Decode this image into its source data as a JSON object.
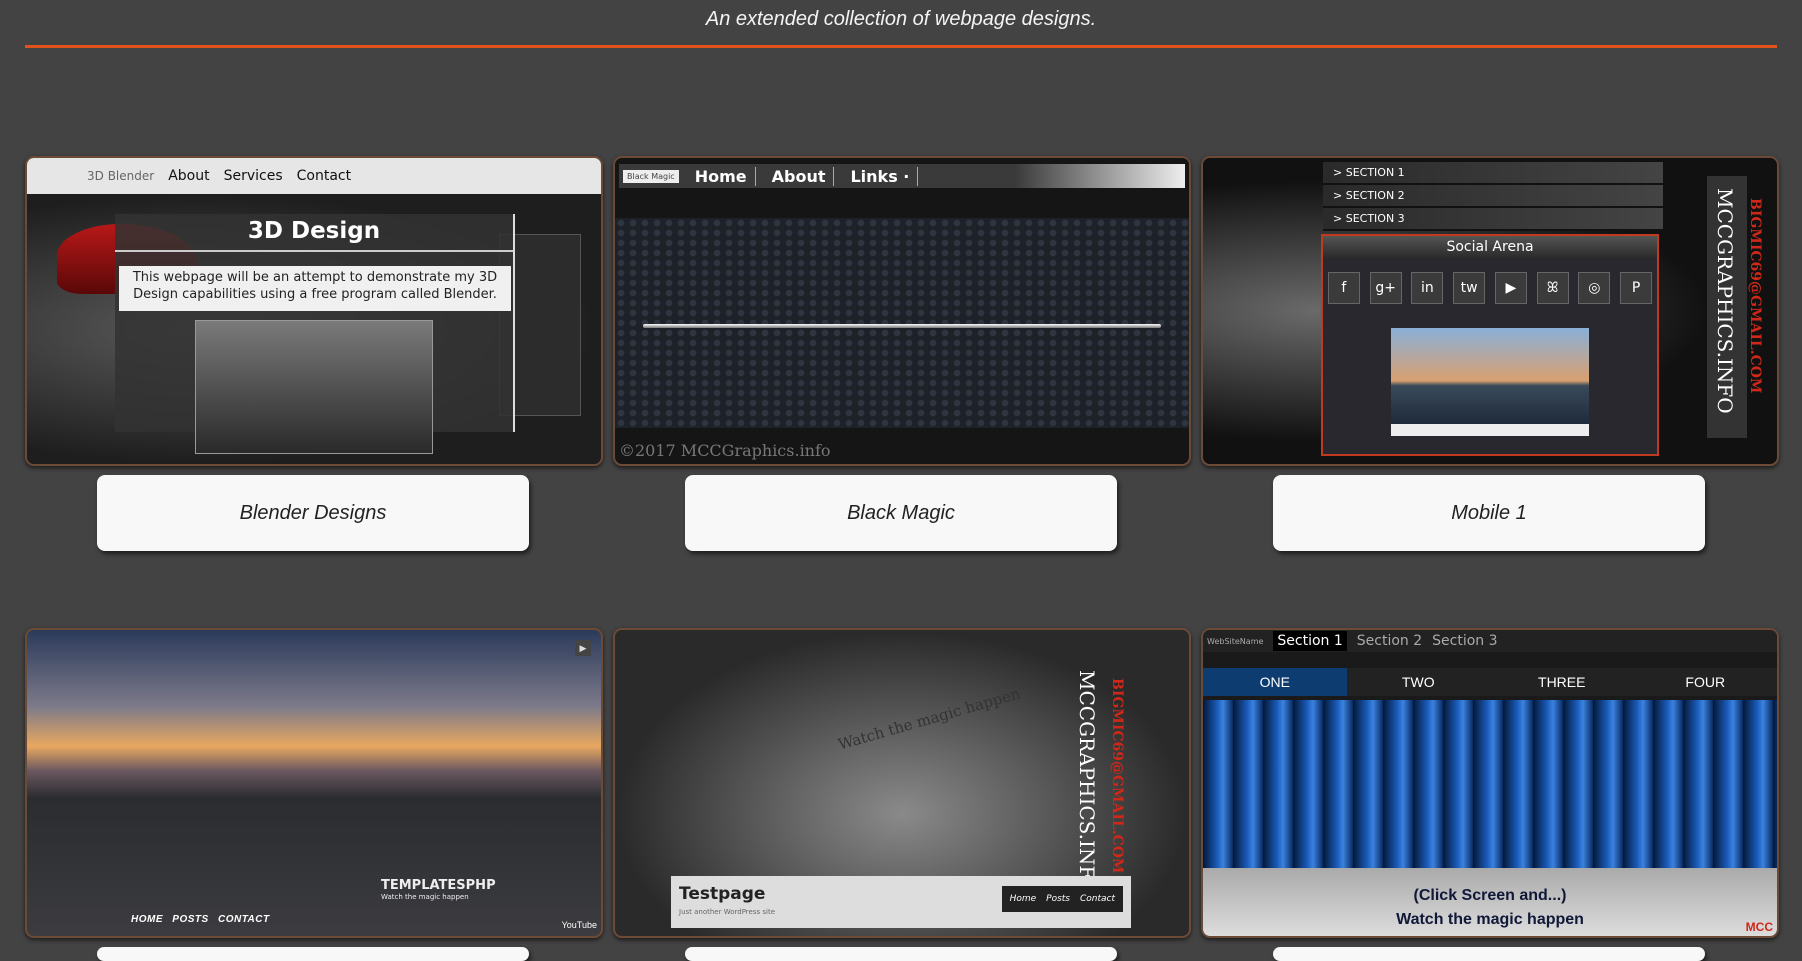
{
  "header": {
    "tagline": "An extended collection of webpage designs.",
    "accent_color": "#e0541c"
  },
  "cards": [
    {
      "label": "Blender Designs",
      "preview": {
        "brand": "3D Blender",
        "nav": [
          "About",
          "Services",
          "Contact"
        ],
        "title": "3D Design",
        "description": "This webpage will be an attempt to demonstrate my 3D Design capabilities using a free program called Blender."
      }
    },
    {
      "label": "Black Magic",
      "preview": {
        "brand": "Black Magic",
        "nav": [
          "Home",
          "About",
          "Links ·"
        ],
        "footer": "©2017 MCCGraphics.info"
      }
    },
    {
      "label": "Mobile 1",
      "preview": {
        "menu": [
          "> SECTION 1",
          "> SECTION 2",
          "> SECTION 3"
        ],
        "panel_title": "Social Arena",
        "social_icons": [
          "f",
          "g+",
          "in",
          "tw",
          "▶",
          "ꕤ",
          "◎",
          "P"
        ],
        "vertical_text": "MCCGRAPHICS.INFO",
        "vertical_email": "BIGMIC69@GMAIL.COM"
      }
    },
    {
      "label": "",
      "preview": {
        "brand": "TEMPLATESPHP",
        "brand_sub": "Watch the magic happen",
        "nav": [
          "HOME",
          "POSTS",
          "CONTACT"
        ],
        "youtube": "YouTube"
      }
    },
    {
      "label": "",
      "preview": {
        "vertical_text": "MCCGRAPHICS.INFO",
        "vertical_email": "BIGMIC69@GMAIL.COM",
        "banner": "Watch the magic happen",
        "title": "Testpage",
        "subtitle": "Just another WordPress site",
        "nav": [
          "Home",
          "Posts",
          "Contact"
        ]
      }
    },
    {
      "label": "",
      "preview": {
        "site_name": "WebSiteName",
        "sections": [
          "Section 1",
          "Section 2",
          "Section 3"
        ],
        "tabs": [
          "ONE",
          "TWO",
          "THREE",
          "FOUR"
        ],
        "message_line1": "(Click Screen and...)",
        "message_line2": "Watch the magic happen",
        "corner_logo": "MCC"
      }
    }
  ]
}
